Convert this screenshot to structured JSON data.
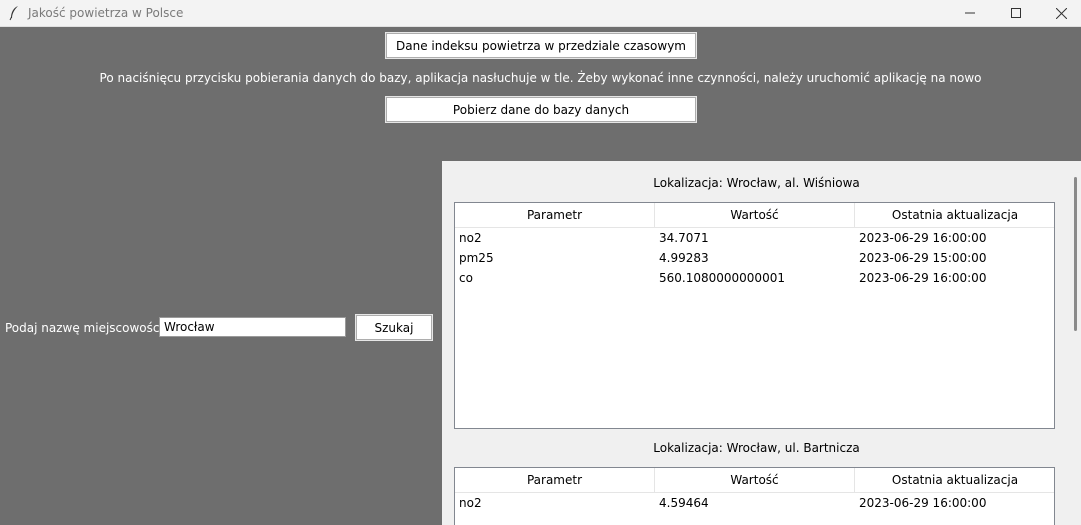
{
  "window": {
    "title": "Jakość powietrza w Polsce",
    "icon": "feather-icon"
  },
  "top": {
    "index_button": "Dane indeksu powietrza w przedziale czasowym",
    "info": "Po naciśnięcu przycisku pobierania danych do bazy, aplikacja nasłuchuje w tle. Żeby wykonać inne czynności, należy uruchomić aplikację na nowo",
    "download_button": "Pobierz dane do bazy danych"
  },
  "search": {
    "label": "Podaj nazwę miejscowości:",
    "value": "Wrocław",
    "button": "Szukaj"
  },
  "columns": [
    "Parametr",
    "Wartość",
    "Ostatnia aktualizacja"
  ],
  "locations": [
    {
      "title": "Lokalizacja: Wrocław, al. Wiśniowa",
      "rows": [
        [
          "no2",
          "34.7071",
          "2023-06-29 16:00:00"
        ],
        [
          "pm25",
          "4.99283",
          "2023-06-29 15:00:00"
        ],
        [
          "co",
          "560.1080000000001",
          "2023-06-29 16:00:00"
        ]
      ]
    },
    {
      "title": "Lokalizacja: Wrocław, ul. Bartnicza",
      "rows": [
        [
          "no2",
          "4.59464",
          "2023-06-29 16:00:00"
        ]
      ]
    }
  ]
}
